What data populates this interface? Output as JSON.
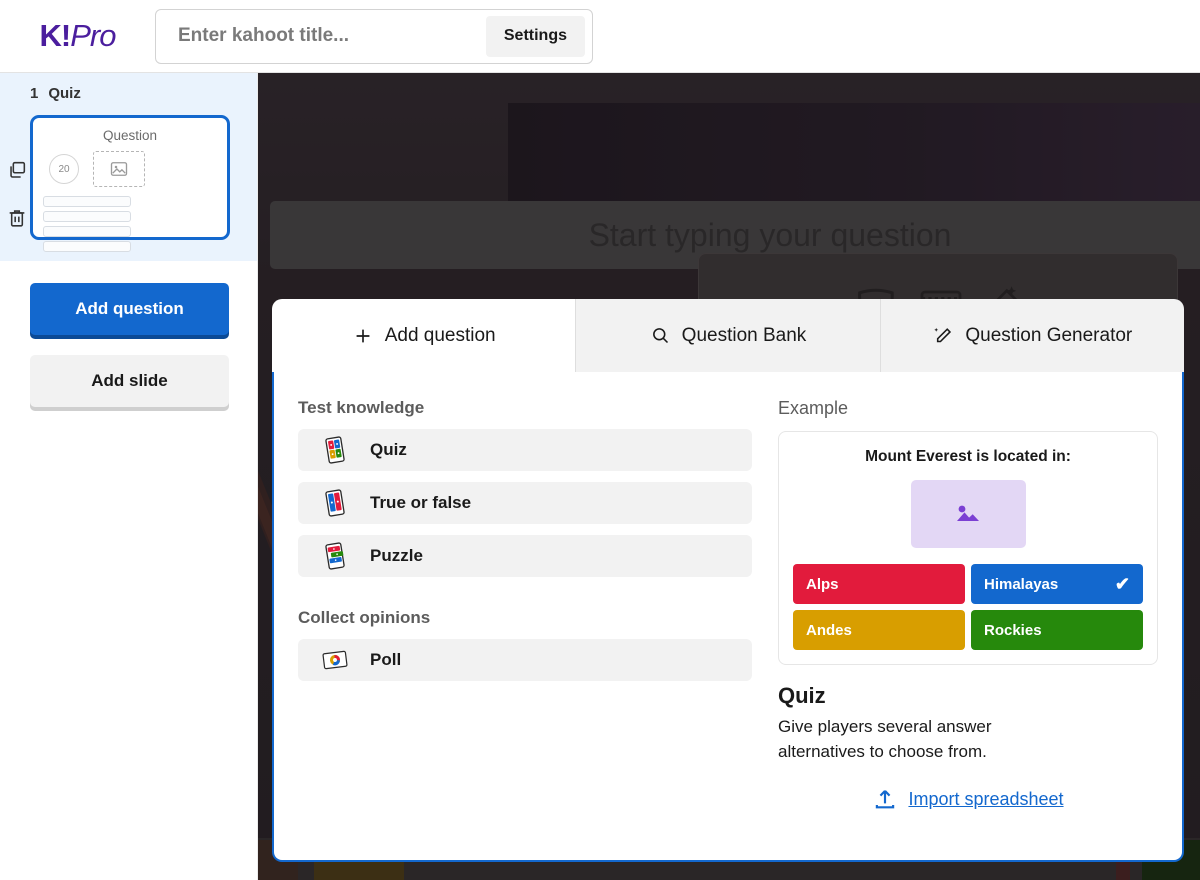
{
  "header": {
    "logo_k": "K!",
    "logo_pro": "Pro",
    "title_placeholder": "Enter kahoot title...",
    "title_value": "",
    "settings_label": "Settings"
  },
  "sidebar": {
    "slide": {
      "number": "1",
      "type_label": "Quiz",
      "thumb_question": "Question",
      "thumb_timer": "20",
      "duplicate_icon": "duplicate-icon",
      "delete_icon": "trash-icon"
    },
    "add_question_label": "Add question",
    "add_slide_label": "Add slide"
  },
  "editor": {
    "question_placeholder": "Start typing your question",
    "media_icons": [
      "theatre-mask-icon",
      "video-icon",
      "magic-wand-icon"
    ]
  },
  "modal": {
    "tabs": [
      {
        "label": "Add question",
        "icon": "plus-icon",
        "active": true
      },
      {
        "label": "Question Bank",
        "icon": "search-icon",
        "active": false
      },
      {
        "label": "Question Generator",
        "icon": "magic-pencil-icon",
        "active": false
      }
    ],
    "groups": [
      {
        "title": "Test knowledge",
        "items": [
          {
            "label": "Quiz",
            "icon": "quiz-icon"
          },
          {
            "label": "True or false",
            "icon": "true-false-icon"
          },
          {
            "label": "Puzzle",
            "icon": "puzzle-icon"
          }
        ]
      },
      {
        "title": "Collect opinions",
        "items": [
          {
            "label": "Poll",
            "icon": "poll-icon"
          }
        ]
      }
    ],
    "example": {
      "heading": "Example",
      "question": "Mount Everest is located in:",
      "image_icon": "image-placeholder-icon",
      "answers": [
        {
          "text": "Alps",
          "color": "#E21B3C",
          "correct": false
        },
        {
          "text": "Himalayas",
          "color": "#1368CE",
          "correct": true
        },
        {
          "text": "Andes",
          "color": "#D89E00",
          "correct": false
        },
        {
          "text": "Rockies",
          "color": "#26890C",
          "correct": false
        }
      ],
      "correct_mark": "✔"
    },
    "description": {
      "title": "Quiz",
      "body": "Give players several answer alternatives to choose from."
    },
    "import": {
      "icon": "upload-icon",
      "label": "Import spreadsheet"
    }
  },
  "colors": {
    "brand_purple": "#4B1E9E",
    "accent_blue": "#1368CE",
    "red": "#E21B3C",
    "yellow": "#D89E00",
    "green": "#26890C"
  }
}
